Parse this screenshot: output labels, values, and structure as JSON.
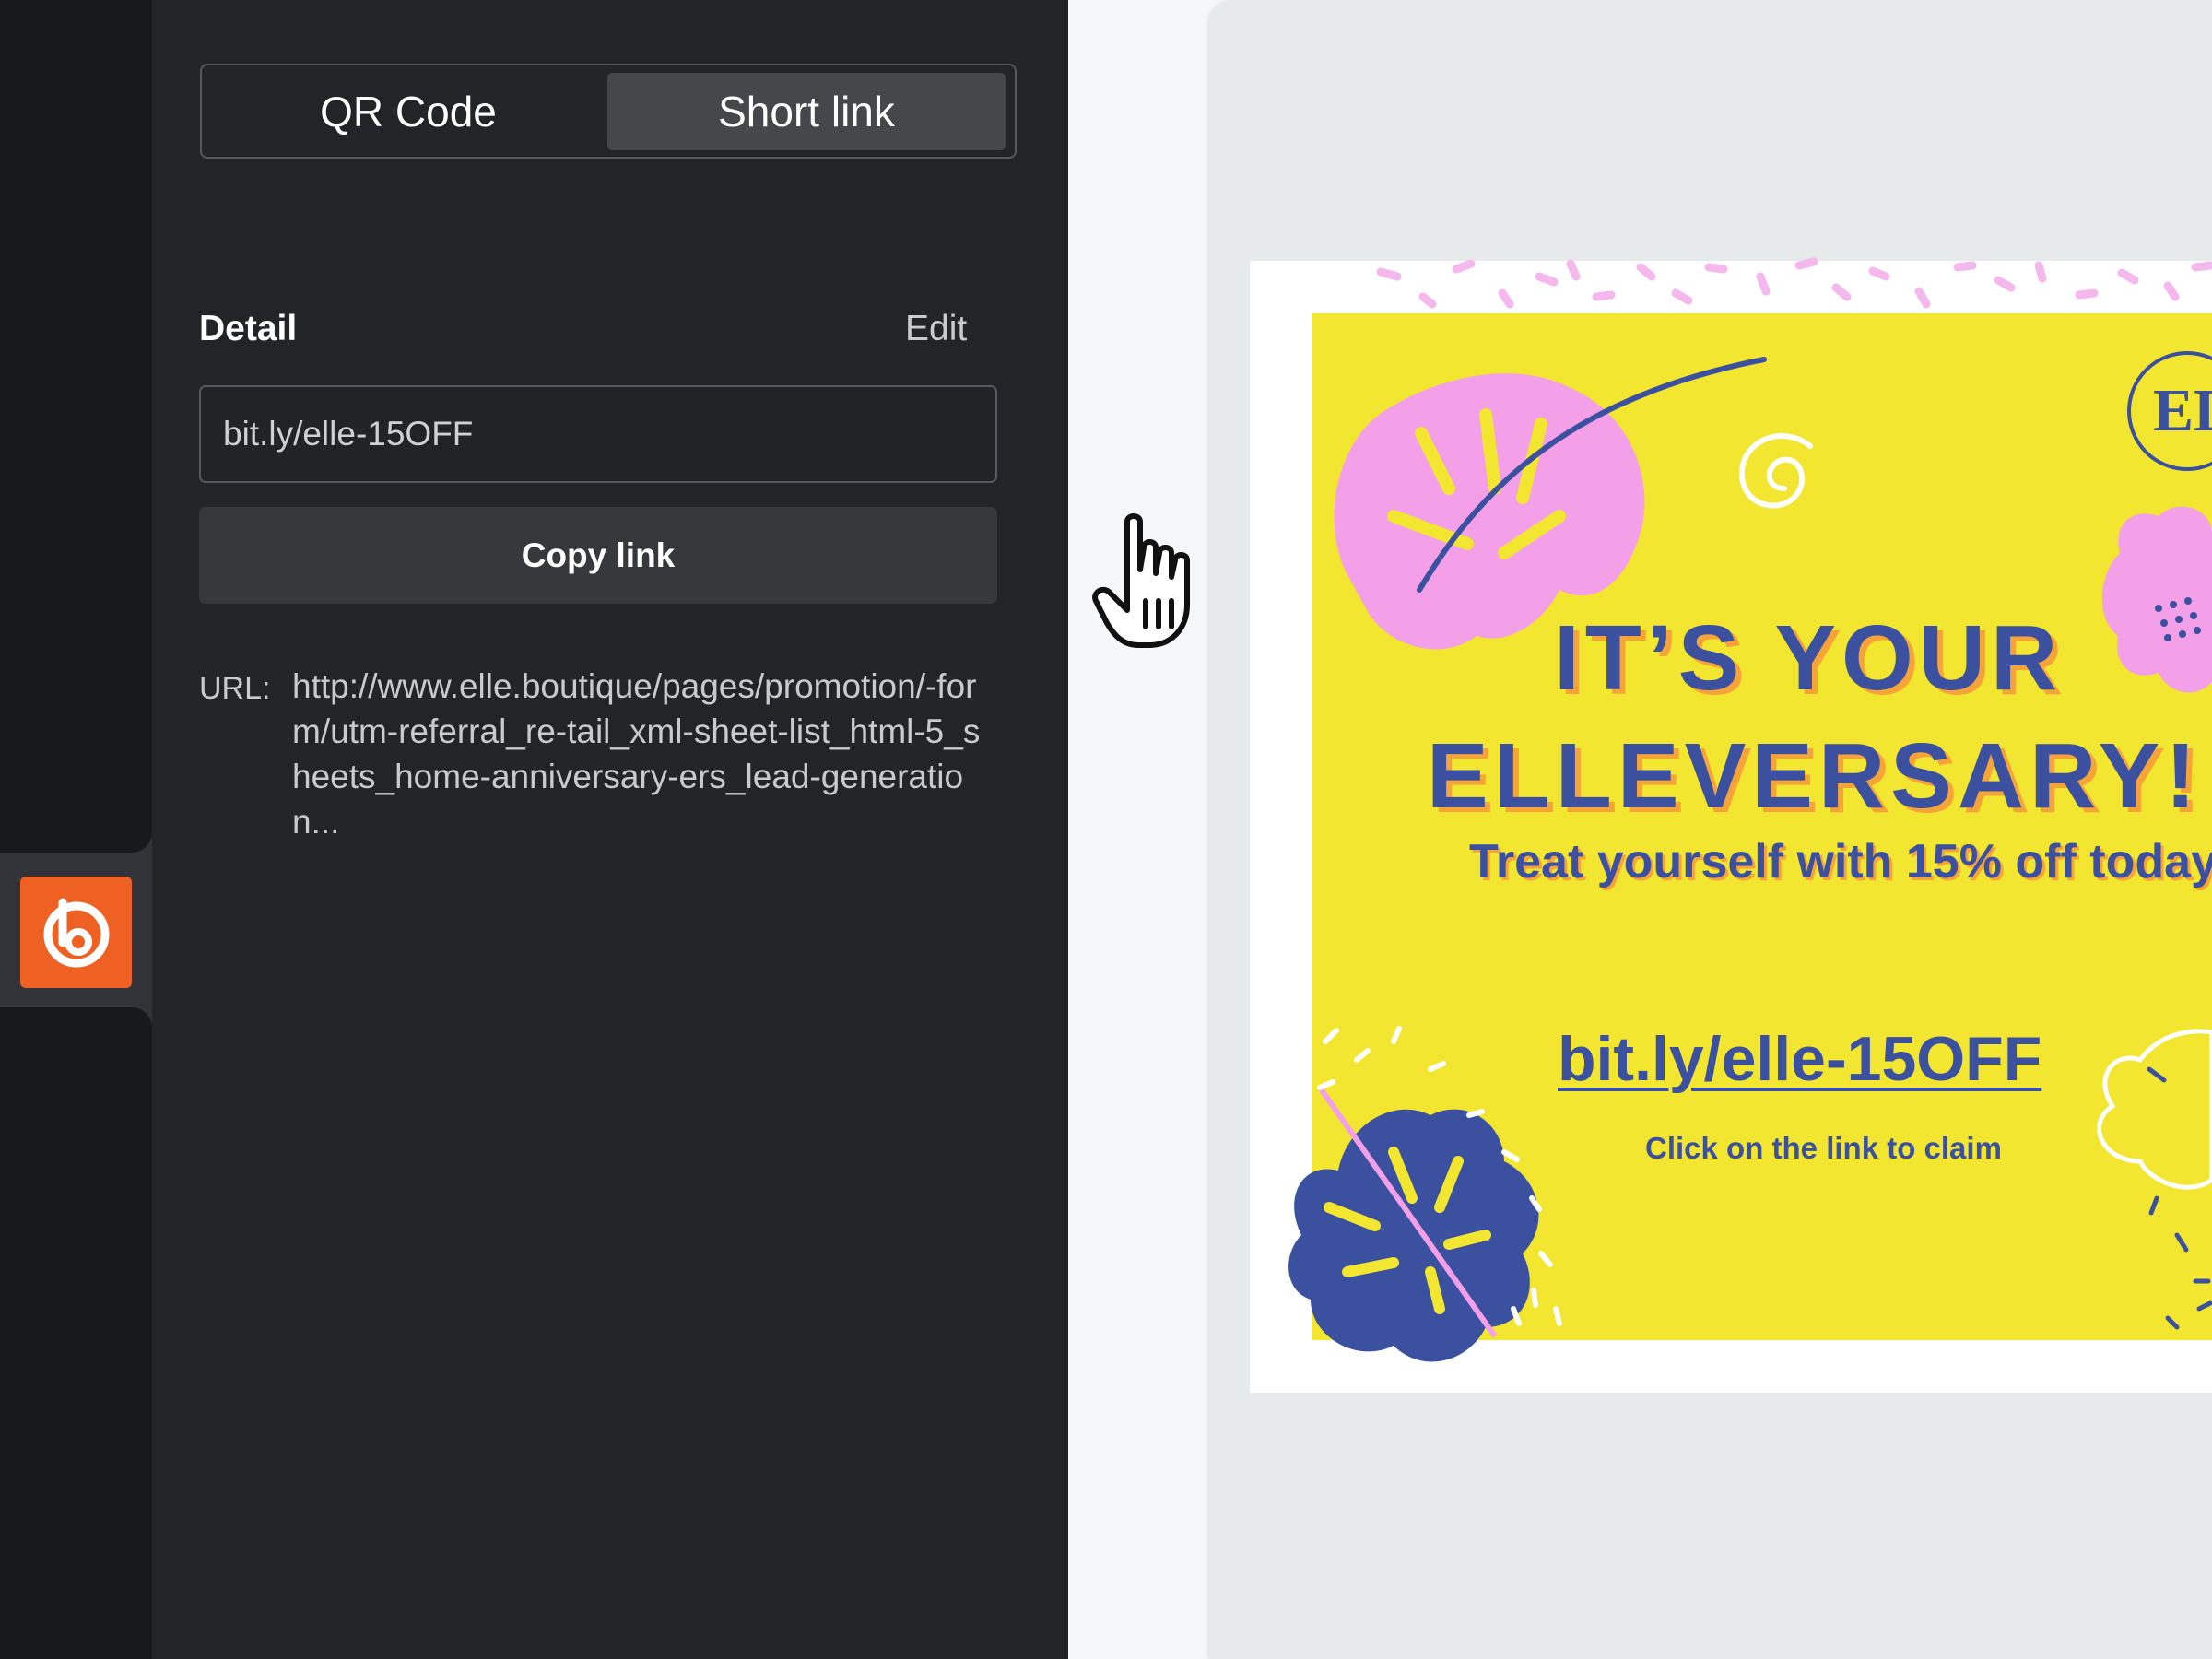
{
  "toggle": {
    "qr_label": "QR Code",
    "short_label": "Short link",
    "selected": "Short link"
  },
  "detail": {
    "label": "Detail",
    "edit_label": "Edit",
    "short_link": "bit.ly/elle-15OFF",
    "copy_label": "Copy link",
    "url_label": "URL:",
    "url_value": "http://www.elle.boutique/pages/promotion/-form/utm-referral_re-tail_xml-sheet-list_html-5_sheets_home-anniversary-ers_lead-generation..."
  },
  "preview": {
    "headline_line1": "IT’S YOUR",
    "headline_line2": "ELLEVERSARY!",
    "subhead": "Treat yourself with 15% off today",
    "link_text": "bit.ly/elle-15OFF",
    "claim_text": "Click on the link to claim",
    "brand_initials": "EL"
  },
  "colors": {
    "brand_orange": "#ee6123",
    "panel_bg": "#232427",
    "promo_yellow": "#f2e630",
    "promo_blue": "#3c50a0",
    "promo_pink": "#f4a0e8"
  },
  "icons": {
    "brand_logo": "bitly-logo-icon",
    "cursor": "hand-pointer-icon"
  }
}
